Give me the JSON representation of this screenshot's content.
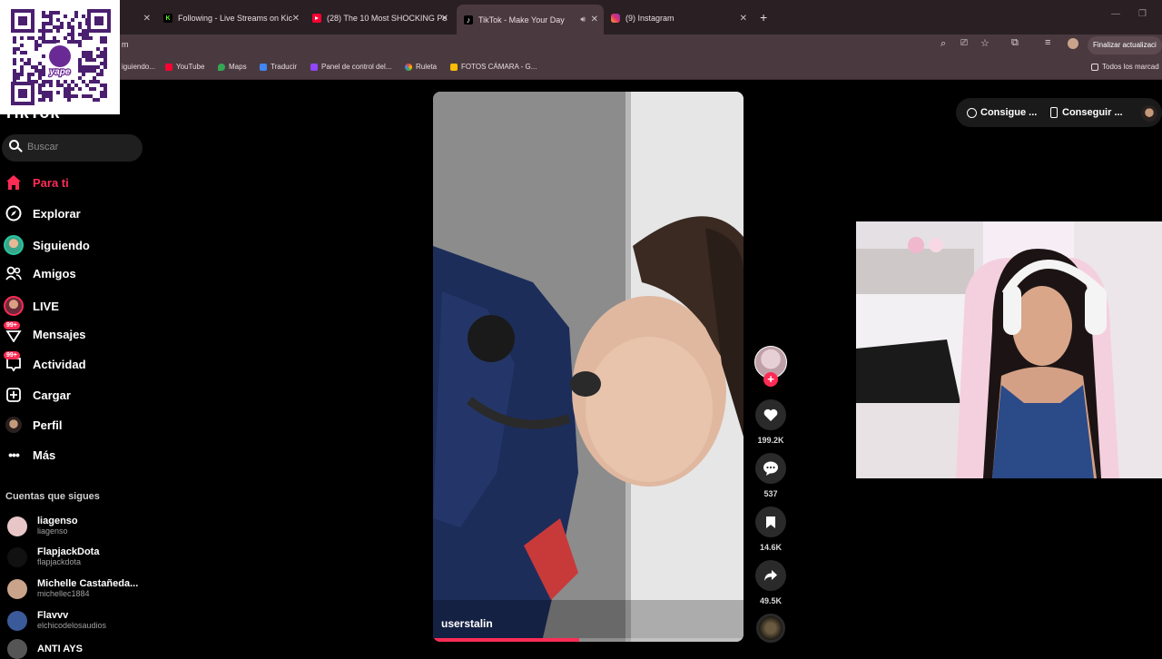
{
  "browser": {
    "tabs": [
      {
        "label": "Following - Live Streams on Kic",
        "icon": "kick-icon",
        "color": "#53fc18"
      },
      {
        "label": "(28) The 10 Most SHOCKING Pe",
        "icon": "youtube-icon",
        "color": "#ff0033"
      },
      {
        "label": "TikTok - Make Your Day",
        "icon": "tiktok-icon",
        "color": "#000000"
      },
      {
        "label": "(9) Instagram",
        "icon": "instagram-icon",
        "color": "#e1306c"
      }
    ],
    "new_tab": "+",
    "address_fragment": "m",
    "update_button": "Finalizar actualizaci",
    "bookmarks": [
      {
        "label": "iguiendo...",
        "color": "#9146ff"
      },
      {
        "label": "YouTube",
        "color": "#ff0033"
      },
      {
        "label": "Maps",
        "color": "#34a853"
      },
      {
        "label": "Traducir",
        "color": "#4285f4"
      },
      {
        "label": "Panel de control del...",
        "color": "#9146ff"
      },
      {
        "label": "Ruleta",
        "color": "#fbbc05"
      },
      {
        "label": "FOTOS CÁMARA - G...",
        "color": "#34a853"
      }
    ],
    "all_bookmarks": "Todos los marcad"
  },
  "qr": {
    "brand": "yape"
  },
  "tiktok": {
    "logo": "TikTok",
    "search_placeholder": "Buscar",
    "nav": [
      {
        "label": "Para ti",
        "icon": "home-icon",
        "active": true
      },
      {
        "label": "Explorar",
        "icon": "compass-icon"
      },
      {
        "label": "Siguiendo",
        "icon": "following-avatar-icon"
      },
      {
        "label": "Amigos",
        "icon": "friends-icon"
      },
      {
        "label": "LIVE",
        "icon": "live-avatar-icon"
      },
      {
        "label": "Mensajes",
        "icon": "messages-icon",
        "badge": "99+"
      },
      {
        "label": "Actividad",
        "icon": "activity-icon",
        "badge": "99+"
      },
      {
        "label": "Cargar",
        "icon": "upload-icon"
      },
      {
        "label": "Perfil",
        "icon": "profile-icon"
      },
      {
        "label": "Más",
        "icon": "more-icon"
      }
    ],
    "following_heading": "Cuentas que sigues",
    "accounts": [
      {
        "name": "liagenso",
        "username": "liagenso",
        "color": "#e8c6c8"
      },
      {
        "name": "FlapjackDota",
        "username": "flapjackdota",
        "color": "#111111"
      },
      {
        "name": "Michelle Castañeda...",
        "username": "michellec1884",
        "color": "#c9a48a"
      },
      {
        "name": "Flavvv",
        "username": "elchicodelosaudios",
        "color": "#3a5a9a"
      },
      {
        "name": "ANTI AYS",
        "username": "",
        "color": "#555555"
      }
    ],
    "video": {
      "username": "userstalin",
      "progress_fraction": 0.47
    },
    "actions": [
      {
        "name": "like",
        "icon": "heart-icon",
        "count": "199.2K"
      },
      {
        "name": "comment",
        "icon": "comment-icon",
        "count": "537"
      },
      {
        "name": "save",
        "icon": "bookmark-icon",
        "count": "14.6K"
      },
      {
        "name": "share",
        "icon": "share-icon",
        "count": "49.5K"
      }
    ],
    "top_right": {
      "coins_button": "Consigue ...",
      "app_button": "Conseguir ..."
    }
  },
  "colors": {
    "accent": "#fe2c55",
    "chrome_dark": "#2a1f23",
    "chrome": "#4a3a3f"
  }
}
